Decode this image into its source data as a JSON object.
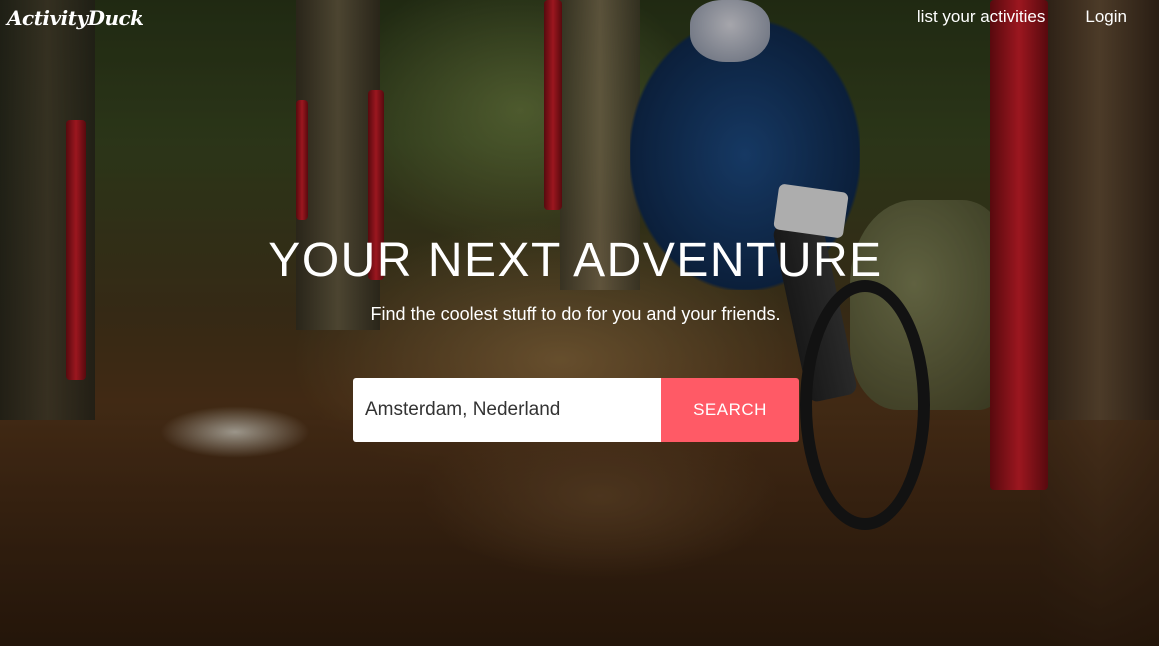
{
  "brand": {
    "logo_text": "ActivityDuck"
  },
  "nav": {
    "items": [
      {
        "label": "list your activities"
      },
      {
        "label": "Login"
      }
    ]
  },
  "hero": {
    "headline": "YOUR NEXT ADVENTURE",
    "subline": "Find the coolest stuff to do for you and your friends.",
    "background": "mountain-bike-rider-forest-photo"
  },
  "search": {
    "location_value": "Amsterdam, Nederland",
    "button_label": "SEARCH"
  },
  "colors": {
    "accent": "#ff5a66",
    "text_on_image": "#ffffff"
  }
}
